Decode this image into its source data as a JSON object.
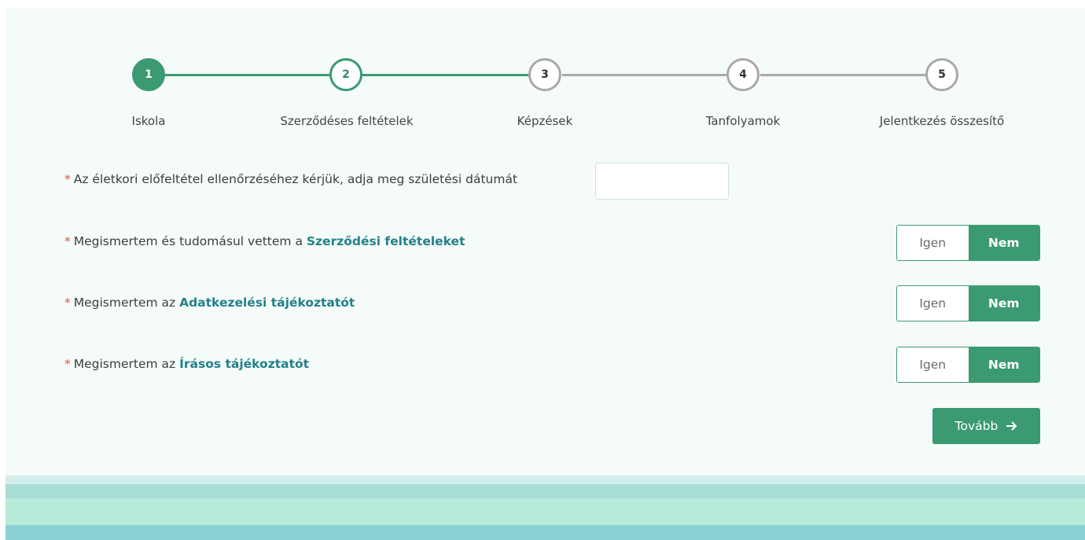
{
  "stepper": {
    "steps": [
      {
        "number": "1",
        "label": "Iskola",
        "state": "done"
      },
      {
        "number": "2",
        "label": "Szerződéses feltételek",
        "state": "active"
      },
      {
        "number": "3",
        "label": "Képzések",
        "state": "todo"
      },
      {
        "number": "4",
        "label": "Tanfolyamok",
        "state": "todo"
      },
      {
        "number": "5",
        "label": "Jelentkezés összesítő",
        "state": "todo"
      }
    ]
  },
  "form": {
    "required_mark": "*",
    "birthdate": {
      "label": "Az életkori előfeltétel ellenőrzéséhez kérjük, adja meg születési dátumát",
      "value": "",
      "icon": "calendar-icon"
    },
    "terms": {
      "label_prefix": "Megismertem és tudomásul vettem a ",
      "link": "Szerződési feltételeket",
      "yes": "Igen",
      "no": "Nem",
      "selected": "no"
    },
    "privacy": {
      "label_prefix": "Megismertem az ",
      "link": "Adatkezelési tájékoztatót",
      "yes": "Igen",
      "no": "Nem",
      "selected": "no"
    },
    "written": {
      "label_prefix": "Megismertem az ",
      "link": "Írásos tájékoztatót",
      "yes": "Igen",
      "no": "Nem",
      "selected": "no"
    },
    "next_button": {
      "label": "Tovább",
      "icon": "arrow-right-icon"
    }
  },
  "colors": {
    "accent": "#3b9a72",
    "link": "#22808a",
    "required": "#e0533f",
    "inactive": "#a9a9a9"
  }
}
